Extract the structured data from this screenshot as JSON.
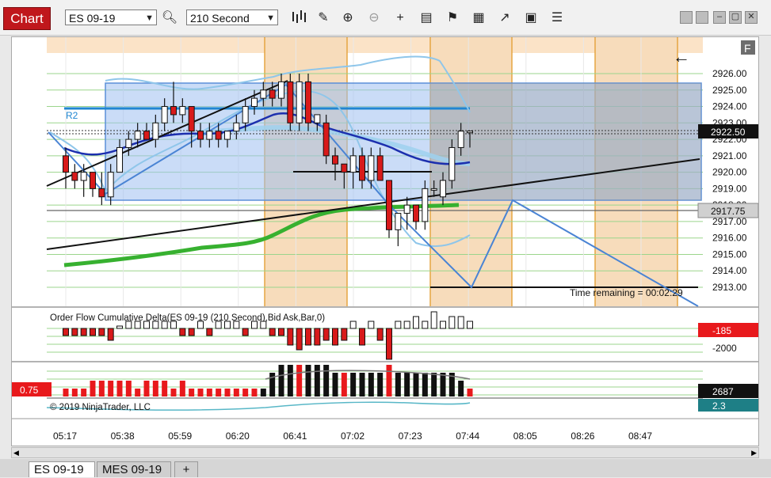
{
  "toolbar": {
    "chart_label": "Chart",
    "instrument": "ES 09-19",
    "interval": "210 Second",
    "icons": [
      "search-icon",
      "bar-style-icon",
      "pencil-icon",
      "zoom-in-icon",
      "zoom-out-icon",
      "crosshair-icon",
      "data-box-icon",
      "properties-icon",
      "strategies-icon",
      "indicators-icon",
      "templates-icon",
      "list-icon"
    ]
  },
  "tabs": [
    {
      "label": "ES 09-19",
      "active": true
    },
    {
      "label": "MES 09-19",
      "active": false
    },
    {
      "label": "+",
      "active": false
    }
  ],
  "panel": {
    "f_button": "F",
    "arrow_label": "←",
    "r2_label": "R2",
    "time_remaining": "Time remaining = 00:02:29",
    "indicator_label": "Order Flow Cumulative Delta(ES 09-19 (210 Second),Bid Ask,Bar,0)",
    "copyright": "© 2019 NinjaTrader, LLC",
    "left_value_badge": "0.75"
  },
  "price_axis": {
    "labels": [
      "2926.00",
      "2925.00",
      "2924.00",
      "2923.00",
      "2922.00",
      "2921.00",
      "2920.00",
      "2919.00",
      "2918.00",
      "2917.00",
      "2916.00",
      "2915.00",
      "2914.00",
      "2913.00"
    ],
    "last_price": "2922.50",
    "marker_price": "2917.75",
    "colors": {
      "last": "#111111",
      "marker": "#d0d0d0"
    }
  },
  "delta_axis": {
    "badge": "-185",
    "label": "-2000",
    "badge_color": "#e8191c"
  },
  "volume_axis": {
    "badge": "2687",
    "badge2": "2.3",
    "badge2_color": "#1e7f86"
  },
  "time_axis": {
    "labels": [
      "05:17",
      "05:38",
      "05:59",
      "06:20",
      "06:41",
      "07:02",
      "07:23",
      "07:44",
      "08:05",
      "08:26",
      "08:47"
    ]
  },
  "chart_data": {
    "type": "candlestick",
    "y_range": [
      2912.5,
      2927.0
    ],
    "candles": [
      {
        "o": 2921.0,
        "h": 2921.5,
        "l": 2919.0,
        "c": 2920.0
      },
      {
        "o": 2920.0,
        "h": 2920.5,
        "l": 2919.0,
        "c": 2919.5
      },
      {
        "o": 2919.5,
        "h": 2920.5,
        "l": 2918.5,
        "c": 2920.0
      },
      {
        "o": 2920.0,
        "h": 2920.0,
        "l": 2918.5,
        "c": 2919.0
      },
      {
        "o": 2919.0,
        "h": 2920.0,
        "l": 2918.0,
        "c": 2918.5
      },
      {
        "o": 2918.5,
        "h": 2920.5,
        "l": 2918.0,
        "c": 2920.0
      },
      {
        "o": 2920.0,
        "h": 2922.0,
        "l": 2920.0,
        "c": 2921.5
      },
      {
        "o": 2921.5,
        "h": 2922.5,
        "l": 2921.0,
        "c": 2922.0
      },
      {
        "o": 2922.0,
        "h": 2923.0,
        "l": 2921.5,
        "c": 2922.5
      },
      {
        "o": 2922.5,
        "h": 2923.0,
        "l": 2922.0,
        "c": 2922.0
      },
      {
        "o": 2922.0,
        "h": 2923.5,
        "l": 2921.5,
        "c": 2923.0
      },
      {
        "o": 2923.0,
        "h": 2924.5,
        "l": 2922.5,
        "c": 2924.0
      },
      {
        "o": 2924.0,
        "h": 2925.5,
        "l": 2923.0,
        "c": 2923.5
      },
      {
        "o": 2923.5,
        "h": 2924.5,
        "l": 2923.0,
        "c": 2924.0
      },
      {
        "o": 2924.0,
        "h": 2924.0,
        "l": 2921.5,
        "c": 2922.5
      },
      {
        "o": 2922.5,
        "h": 2923.0,
        "l": 2921.5,
        "c": 2922.0
      },
      {
        "o": 2922.0,
        "h": 2923.0,
        "l": 2921.5,
        "c": 2922.5
      },
      {
        "o": 2922.5,
        "h": 2923.0,
        "l": 2921.5,
        "c": 2922.0
      },
      {
        "o": 2922.0,
        "h": 2922.5,
        "l": 2921.5,
        "c": 2922.5
      },
      {
        "o": 2922.5,
        "h": 2923.5,
        "l": 2922.0,
        "c": 2923.0
      },
      {
        "o": 2923.0,
        "h": 2924.5,
        "l": 2922.5,
        "c": 2924.0
      },
      {
        "o": 2924.0,
        "h": 2925.0,
        "l": 2923.5,
        "c": 2924.5
      },
      {
        "o": 2924.5,
        "h": 2925.5,
        "l": 2924.0,
        "c": 2925.0
      },
      {
        "o": 2925.0,
        "h": 2925.5,
        "l": 2924.0,
        "c": 2924.5
      },
      {
        "o": 2924.5,
        "h": 2926.0,
        "l": 2924.0,
        "c": 2925.5
      },
      {
        "o": 2925.5,
        "h": 2926.0,
        "l": 2922.5,
        "c": 2923.0
      },
      {
        "o": 2923.0,
        "h": 2926.0,
        "l": 2922.5,
        "c": 2925.5
      },
      {
        "o": 2925.5,
        "h": 2926.0,
        "l": 2922.5,
        "c": 2923.0
      },
      {
        "o": 2923.0,
        "h": 2923.5,
        "l": 2922.5,
        "c": 2923.5
      },
      {
        "o": 2923.0,
        "h": 2923.5,
        "l": 2920.5,
        "c": 2921.0
      },
      {
        "o": 2921.0,
        "h": 2921.5,
        "l": 2919.5,
        "c": 2920.5
      },
      {
        "o": 2920.5,
        "h": 2920.5,
        "l": 2919.0,
        "c": 2920.0
      },
      {
        "o": 2920.0,
        "h": 2921.5,
        "l": 2919.0,
        "c": 2921.0
      },
      {
        "o": 2921.0,
        "h": 2921.5,
        "l": 2919.0,
        "c": 2919.5
      },
      {
        "o": 2919.5,
        "h": 2921.5,
        "l": 2919.0,
        "c": 2921.0
      },
      {
        "o": 2921.0,
        "h": 2921.5,
        "l": 2919.5,
        "c": 2919.5
      },
      {
        "o": 2919.5,
        "h": 2919.5,
        "l": 2916.0,
        "c": 2916.5
      },
      {
        "o": 2916.5,
        "h": 2917.5,
        "l": 2915.5,
        "c": 2917.5
      },
      {
        "o": 2917.5,
        "h": 2918.5,
        "l": 2916.5,
        "c": 2918.0
      },
      {
        "o": 2918.0,
        "h": 2918.0,
        "l": 2916.5,
        "c": 2917.0
      },
      {
        "o": 2917.0,
        "h": 2919.5,
        "l": 2916.5,
        "c": 2919.0
      },
      {
        "o": 2919.0,
        "h": 2919.5,
        "l": 2918.5,
        "c": 2919.0
      },
      {
        "o": 2918.5,
        "h": 2920.0,
        "l": 2918.0,
        "c": 2919.5
      },
      {
        "o": 2919.5,
        "h": 2922.0,
        "l": 2919.0,
        "c": 2921.5
      },
      {
        "o": 2921.5,
        "h": 2923.0,
        "l": 2921.0,
        "c": 2922.5
      },
      {
        "o": 2922.5,
        "h": 2922.5,
        "l": 2921.5,
        "c": 2922.5
      }
    ],
    "delta": [
      -1,
      -1,
      -1,
      -1,
      -1,
      -2,
      0,
      1,
      1,
      1,
      1,
      1,
      1,
      -1,
      -1,
      1,
      -1,
      1,
      1,
      1,
      -1,
      1,
      1,
      -1,
      -1,
      -3,
      -4,
      -3,
      -3,
      -2,
      -3,
      -2,
      1,
      -3,
      1,
      -2,
      -6,
      1,
      1,
      2,
      1,
      3,
      1,
      2,
      2,
      1
    ],
    "volume": [
      1,
      1,
      1,
      2,
      2,
      2,
      2,
      2,
      1,
      2,
      2,
      2,
      1,
      2,
      1,
      1,
      1,
      1,
      1,
      1,
      1,
      1,
      1,
      3,
      4,
      4,
      4,
      4,
      4,
      4,
      3,
      3,
      3,
      3,
      3,
      3,
      4,
      3,
      3,
      3,
      3,
      3,
      3,
      3,
      2,
      1
    ],
    "volume_colors": [
      "red",
      "red",
      "red",
      "red",
      "red",
      "red",
      "red",
      "red",
      "red",
      "red",
      "red",
      "red",
      "red",
      "red",
      "red",
      "red",
      "red",
      "red",
      "red",
      "red",
      "red",
      "red",
      "black",
      "black",
      "black",
      "black",
      "red",
      "black",
      "black",
      "black",
      "black",
      "red",
      "black",
      "black",
      "black",
      "black",
      "red",
      "black",
      "black",
      "black",
      "black",
      "black",
      "black",
      "black",
      "black",
      "red"
    ]
  }
}
